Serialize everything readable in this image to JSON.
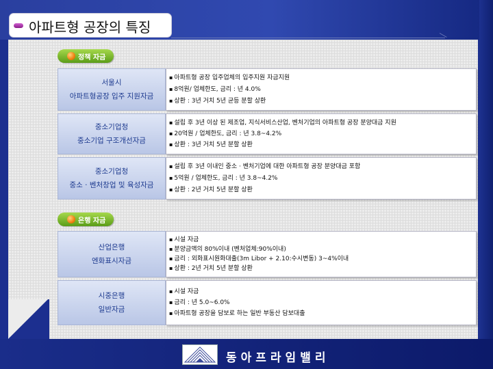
{
  "title": "아파트형 공장의 특징",
  "sections": {
    "policy": "정책 자금",
    "bank": "은행 자금"
  },
  "rows": [
    {
      "label1": "서울시",
      "label2": "아파트형공장 입주 지원자금",
      "bullets": [
        "아파트형 공장 입주업체의 입주지원 자금지원",
        "8억원/ 업체한도, 금리 : 년 4.0%",
        "상환 : 3년 거치 5년 균등 분할 상환"
      ]
    },
    {
      "label1": "중소기업청",
      "label2": "중소기업 구조개선자금",
      "bullets": [
        "설립 후 3년 이상 된 제조업, 지식서비스산업, 벤처기업의 아파트형 공장 분양대금 지원",
        "20억원 / 업체한도, 금리 : 년 3.8~4.2%",
        "상환 : 3년 거치 5년 분할 상환"
      ]
    },
    {
      "label1": "중소기업청",
      "label2": "중소 · 벤처창업 및 육성자금",
      "bullets": [
        "설립 후 3년 이내인 중소 · 벤처기업에 대한 아파트형 공장 분양대금 포함",
        "5억원 / 업체한도, 금리 : 년 3.8~4.2%",
        "상환 : 2년 거치 5년 분할 상환"
      ]
    },
    {
      "label1": "산업은행",
      "label2": "엔화표시자금",
      "bullets": [
        "시설 자금",
        "분양금액의 80%이내 (벤처업체:90%이내)",
        "금리 : 외화표시원화대출(3m Libor + 2.10:수시변동) 3~4%이내",
        "상환 : 2년 거치 5년 분할 상환"
      ]
    },
    {
      "label1": "시중은행",
      "label2": "일반자금",
      "bullets": [
        "시설 자금",
        "금리 : 년 5.0~6.0%",
        "아파트형 공장을 담보로 하는 일반 부동산 담보대출"
      ]
    }
  ],
  "footer": {
    "company": "동아프라임밸리"
  }
}
